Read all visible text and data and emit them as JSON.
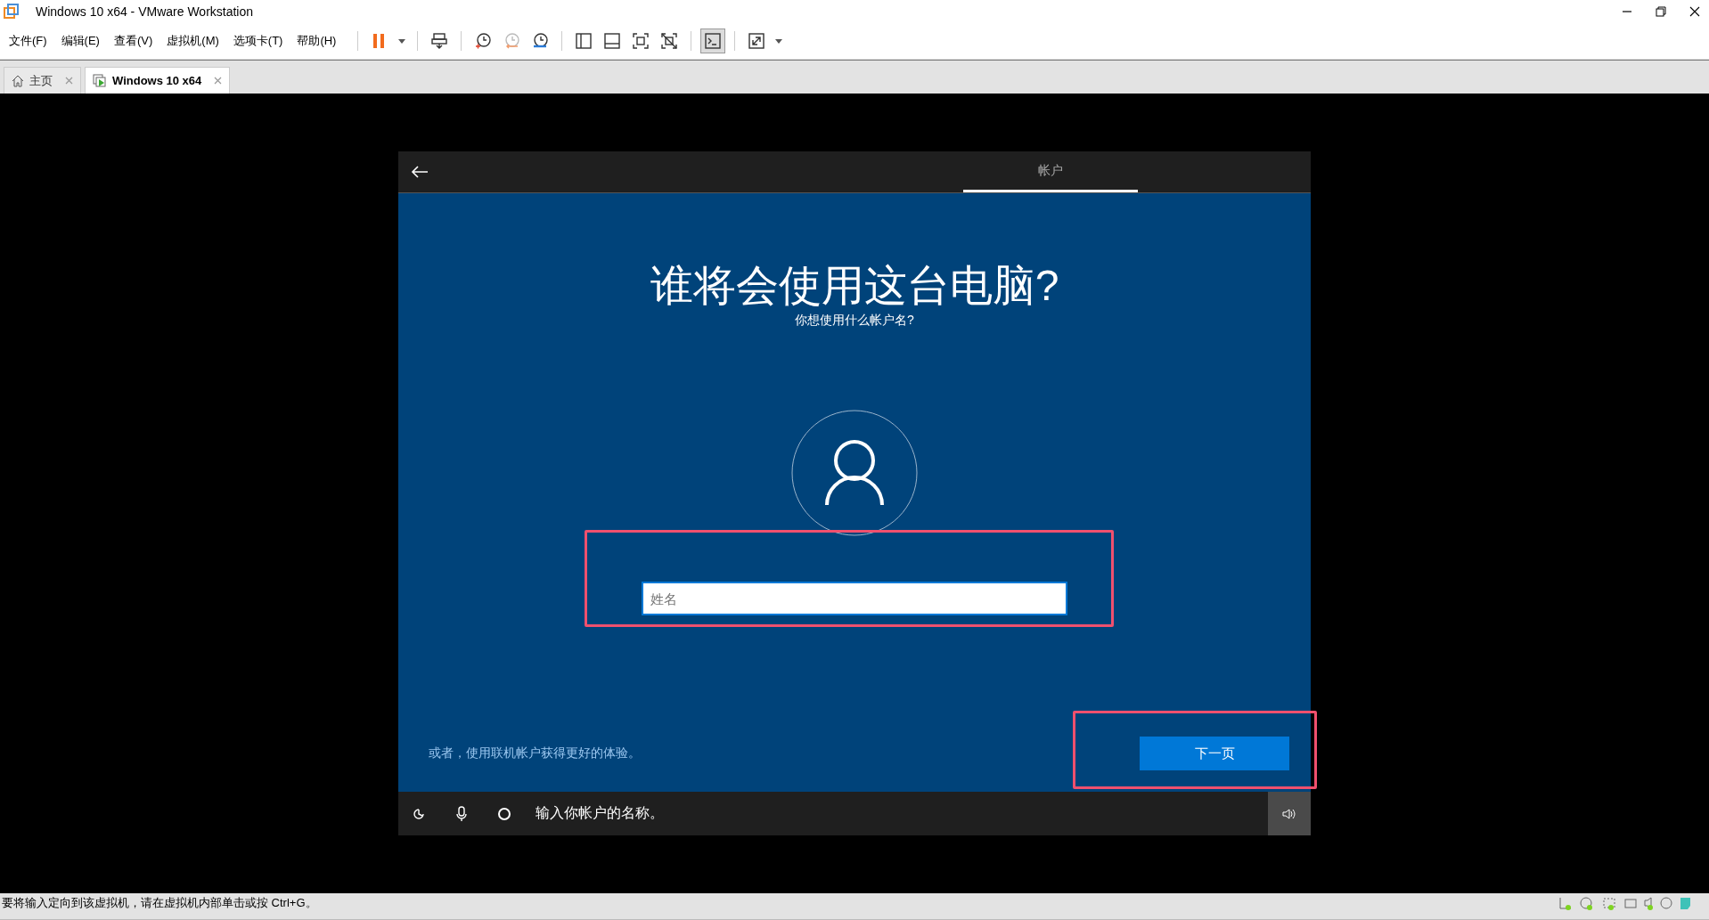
{
  "window": {
    "title": "Windows 10 x64 - VMware Workstation"
  },
  "menu": [
    "文件(F)",
    "编辑(E)",
    "查看(V)",
    "虚拟机(M)",
    "选项卡(T)",
    "帮助(H)"
  ],
  "toolbar": [
    [
      {
        "kind": "pause",
        "pressed": false
      },
      {
        "kind": "caret",
        "pressed": false
      }
    ],
    [
      {
        "kind": "send-keys",
        "pressed": false
      }
    ],
    [
      {
        "kind": "snapshot-take",
        "pressed": false
      },
      {
        "kind": "snapshot-revert",
        "pressed": false
      },
      {
        "kind": "snapshot-manager",
        "pressed": false
      }
    ],
    [
      {
        "kind": "library",
        "pressed": false
      },
      {
        "kind": "thumbnail",
        "pressed": false
      },
      {
        "kind": "fit",
        "pressed": false
      },
      {
        "kind": "unity",
        "pressed": false
      }
    ],
    [
      {
        "kind": "console",
        "pressed": true
      }
    ],
    [
      {
        "kind": "fullscreen",
        "pressed": false
      },
      {
        "kind": "caret",
        "pressed": false
      }
    ]
  ],
  "tabs": [
    {
      "label": "主页",
      "kind": "home",
      "selected": false
    },
    {
      "label": "Windows 10 x64",
      "kind": "vm",
      "selected": true
    }
  ],
  "vm": {
    "header_tab": "帐户",
    "heading": "谁将会使用这台电脑?",
    "subheading": "你想使用什么帐户名?",
    "name_field": {
      "placeholder": "姓名"
    },
    "online_link": "或者，使用联机帐户获得更好的体验。",
    "next_button": "下一页",
    "narration": "输入你帐户的名称。"
  },
  "status_bar": {
    "message": "要将输入定向到该虚拟机，请在虚拟机内部单击或按 Ctrl+G。"
  }
}
